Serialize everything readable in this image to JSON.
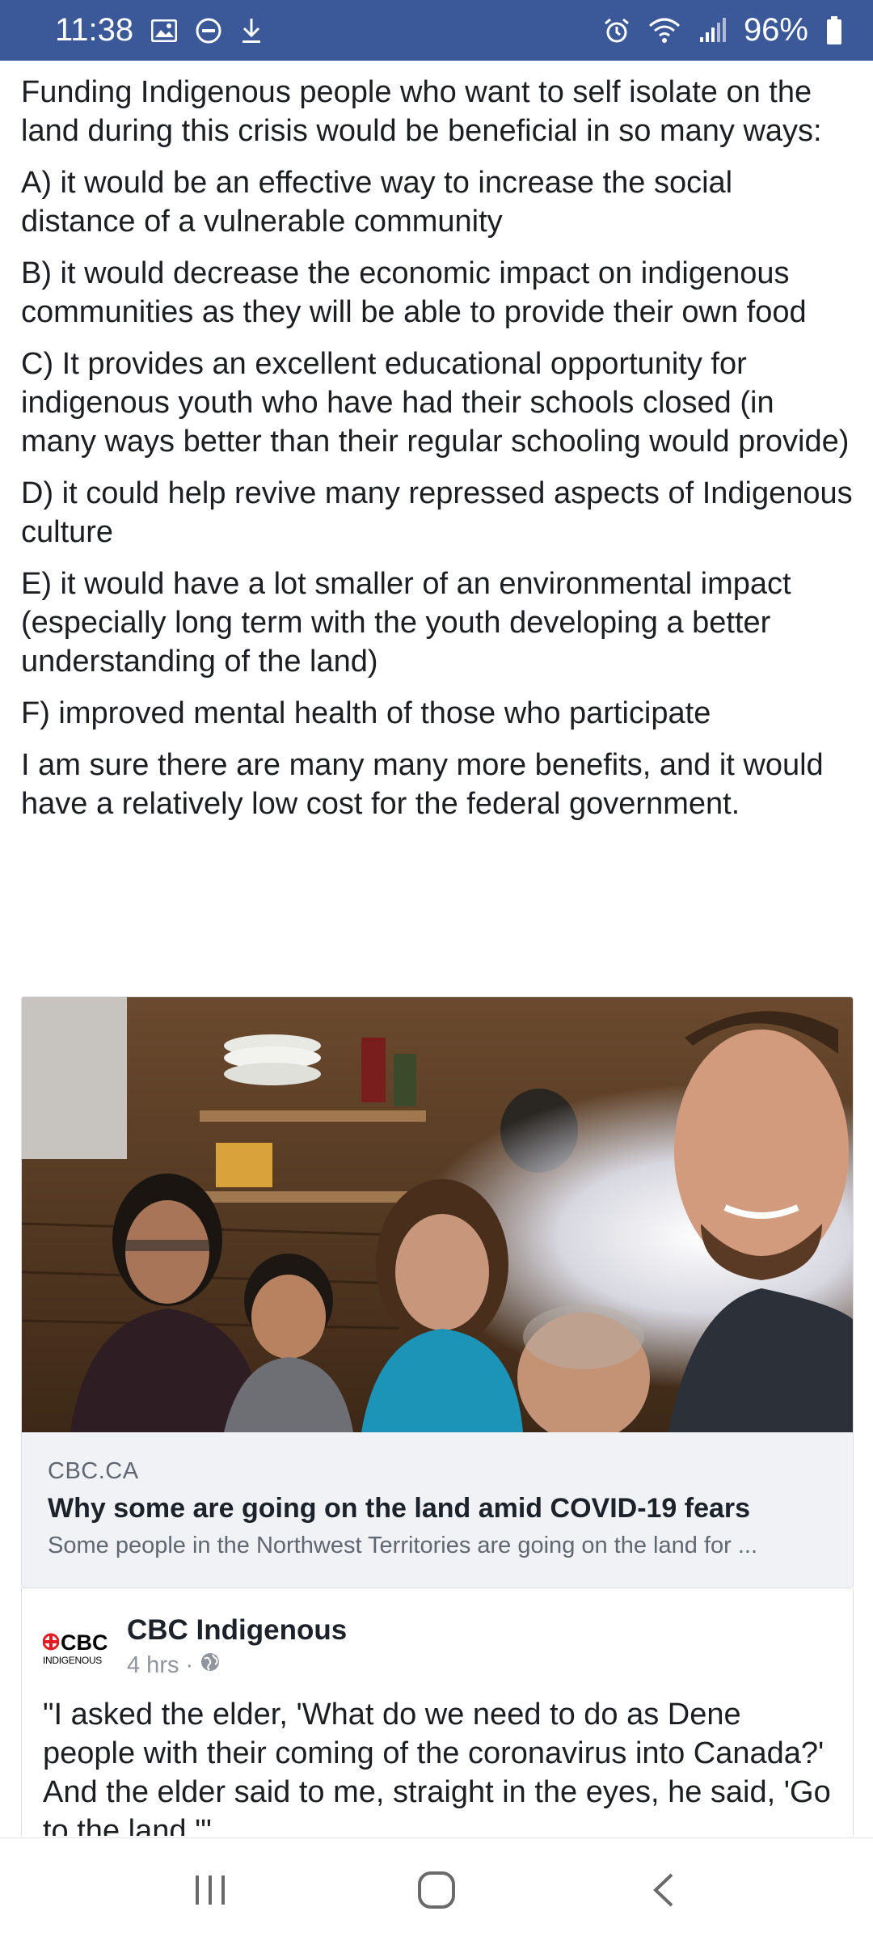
{
  "status_bar": {
    "time": "11:38",
    "battery": "96%",
    "left_icons": [
      "image-icon",
      "dnd-icon",
      "download-icon"
    ],
    "right_icons": [
      "alarm-icon",
      "wifi-icon",
      "signal-icon",
      "battery-icon"
    ]
  },
  "post": {
    "paragraphs": [
      "Funding Indigenous people who want to self isolate on the land during this crisis would be beneficial in so many ways:",
      "A) it would be an effective way to increase the social distance of a vulnerable community",
      "B) it would decrease the economic impact on indigenous communities as they will be able to provide their own food",
      "C) It provides an excellent educational opportunity for indigenous youth who have had their schools closed (in many ways better than their regular schooling would provide)",
      "D) it could help revive many repressed aspects of Indigenous culture",
      "E) it would have a lot smaller of an environmental impact (especially long term with the youth developing a better understanding of the land)",
      "F) improved mental health of those who participate",
      "I am sure there are many many more benefits, and it would have a relatively low cost for the federal government."
    ]
  },
  "link_card": {
    "domain": "CBC.CA",
    "title": "Why some are going on the land amid COVID-19 fears",
    "description": "Some people in the Northwest Territories are going on the land for ..."
  },
  "shared_post": {
    "logo_text": "CBC",
    "logo_sub": "INDIGENOUS",
    "page_name": "CBC Indigenous",
    "time": "4 hrs ·",
    "text": "\"I asked the elder, 'What do we need to do as Dene people with their coming of the coronavirus into Canada?' And the elder said to me, straight in the eyes, he said, 'Go to the land.'\""
  },
  "nav_bar": {
    "buttons": [
      "recent-apps-icon",
      "home-icon",
      "back-icon"
    ]
  },
  "colors": {
    "status_bar_bg": "#3b5998",
    "card_meta_bg": "#f0f2f5",
    "cbc_red": "#e31b23"
  }
}
